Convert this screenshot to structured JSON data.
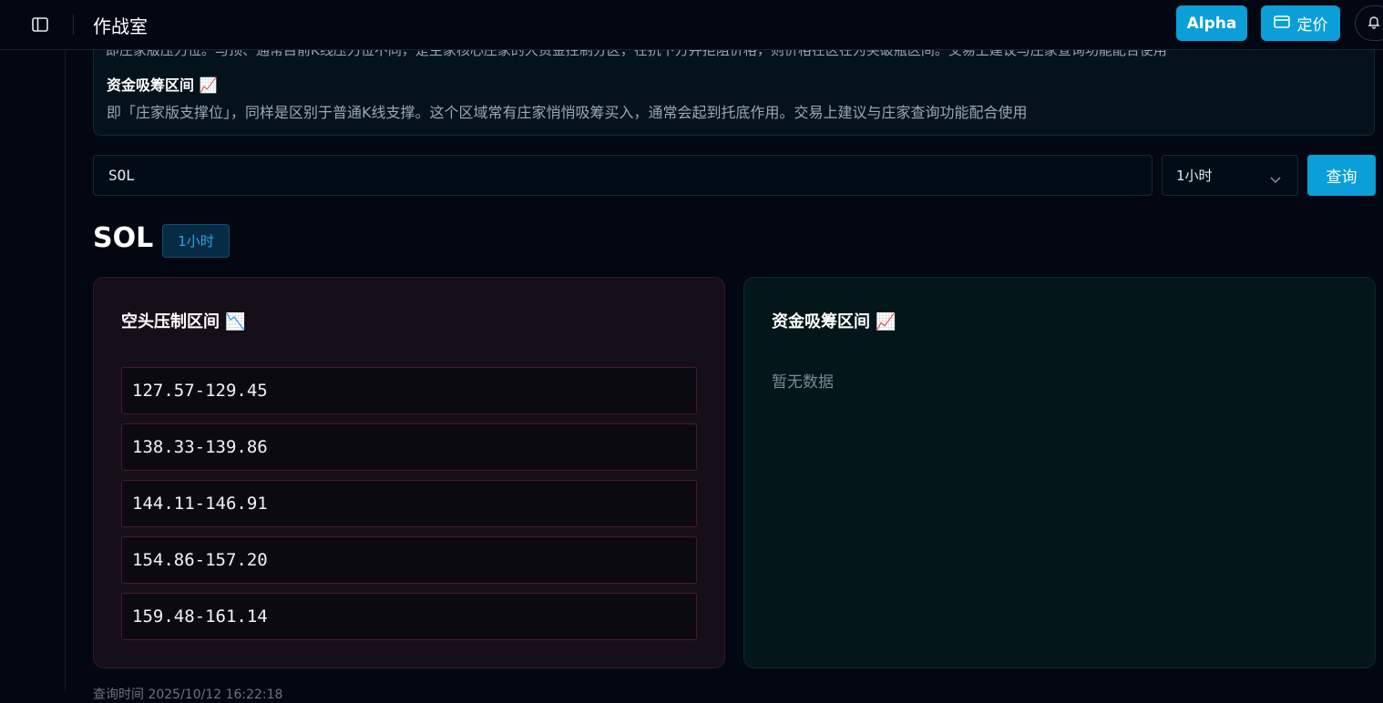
{
  "header": {
    "title": "作战室",
    "alpha_label": "Alpha",
    "pricing_label": "定价"
  },
  "info": {
    "cut_text": "即庄家版压力位。与顶、通常目前K线压力位不同，是主家核心庄家的大资金控制分区，在抗下方并拒阻价格，则价格在区在为突破瓶区间。交易上建议与庄家查询功能配合使用",
    "heading": "资金吸筹区间 📈",
    "description": "即「庄家版支撑位」，同样是区别于普通K线支撑。这个区域常有庄家悄悄吸筹买入，通常会起到托底作用。交易上建议与庄家查询功能配合使用"
  },
  "search": {
    "symbol_value": "SOL",
    "interval_value": "1小时",
    "query_label": "查询"
  },
  "result": {
    "symbol": "SOL",
    "interval_badge": "1小时",
    "short_zone": {
      "title": "空头压制区间 📉",
      "ranges": [
        "127.57-129.45",
        "138.33-139.86",
        "144.11-146.91",
        "154.86-157.20",
        "159.48-161.14"
      ]
    },
    "long_zone": {
      "title": "资金吸筹区间 📈",
      "empty_text": "暂无数据"
    }
  },
  "footer": {
    "cut_text": "查询时间 2025/10/12 16:22:18"
  },
  "colors": {
    "accent": "#0a9fd8",
    "background": "#020712",
    "short_border": "#4a1a22",
    "long_card": "#03171b"
  }
}
